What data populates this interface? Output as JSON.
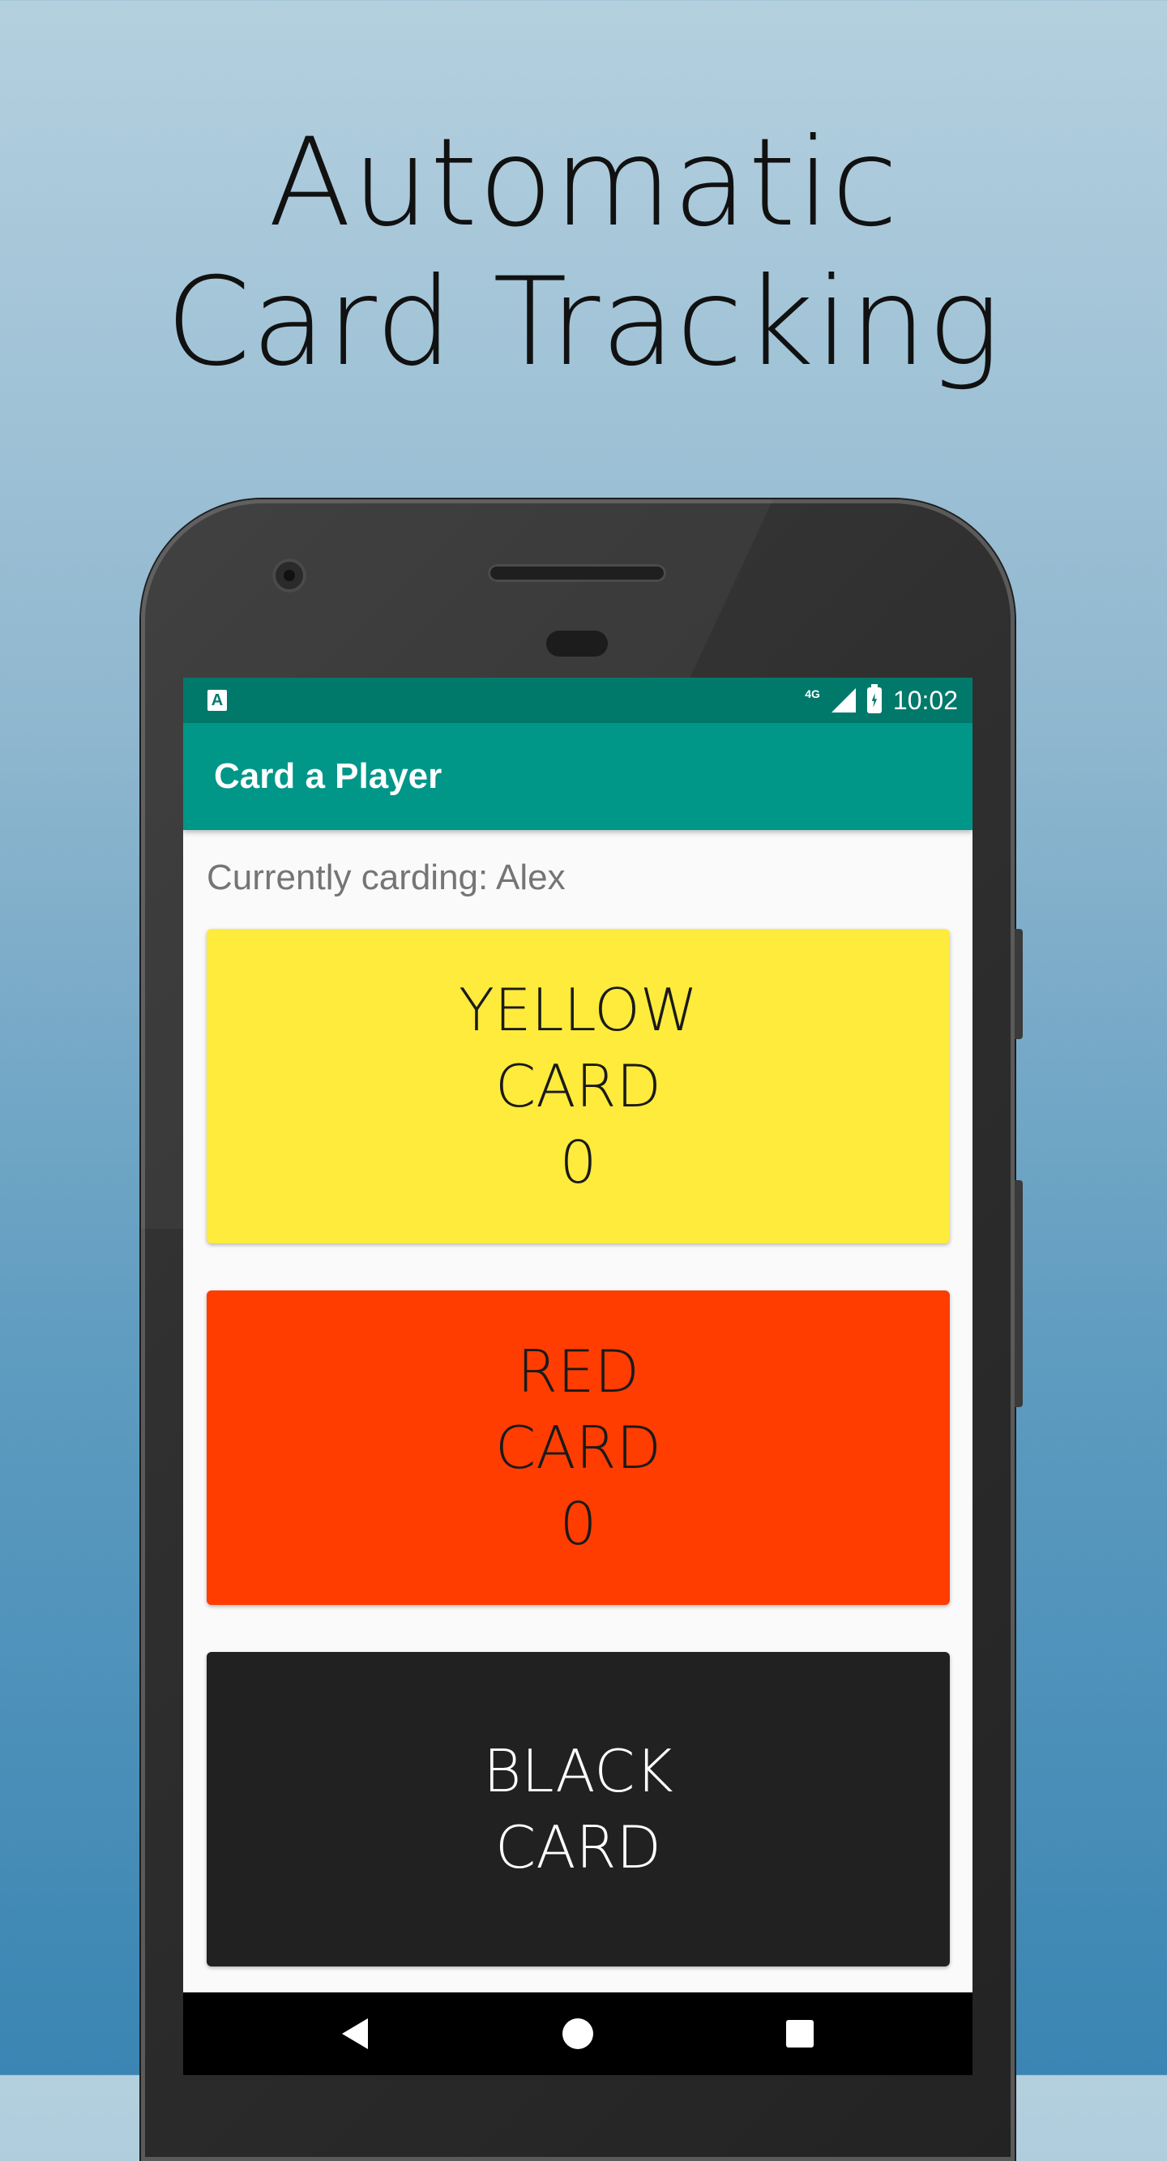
{
  "headline": {
    "line1": "Automatic",
    "line2": "Card Tracking"
  },
  "status_bar": {
    "app_icon": "A",
    "network": "4G",
    "time": "10:02",
    "icons": [
      "app-notification-icon",
      "signal-icon",
      "battery-charging-icon"
    ]
  },
  "app_bar": {
    "title": "Card a Player"
  },
  "carding": {
    "label": "Currently carding: Alex"
  },
  "cards": {
    "yellow": {
      "line1": "YELLOW",
      "line2": "CARD",
      "count": "0",
      "color": "#ffeb3b"
    },
    "red": {
      "line1": "RED",
      "line2": "CARD",
      "count": "0",
      "color": "#ff3d00"
    },
    "black": {
      "line1": "BLACK",
      "line2": "CARD",
      "color": "#212121"
    }
  },
  "nav_bar": {
    "icons": [
      "back-icon",
      "home-icon",
      "recents-icon"
    ]
  },
  "colors": {
    "accent": "#009688",
    "status_bar": "#00796b"
  }
}
